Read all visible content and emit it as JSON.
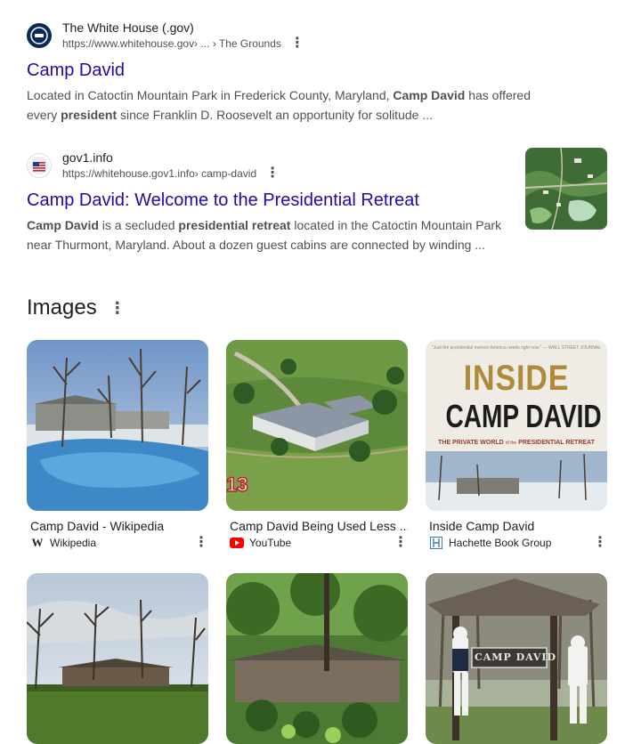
{
  "results": [
    {
      "site_name": "The White House (.gov)",
      "url": "https://www.whitehouse.gov",
      "breadcrumb": " › ... › The Grounds",
      "title": "Camp David",
      "snippet_parts": [
        "Located in Catoctin Mountain Park in Frederick County, Maryland, ",
        "Camp David",
        " has offered",
        "every ",
        "president",
        " since Franklin D. Roosevelt an opportunity for solitude ..."
      ]
    },
    {
      "site_name": "gov1.info",
      "url": "https://whitehouse.gov1.info",
      "breadcrumb": " › camp-david",
      "title": "Camp David: Welcome to the Presidential Retreat",
      "snippet_parts": [
        "Camp David",
        " is a secluded ",
        "presidential retreat",
        " located in the Catoctin Mountain Park",
        "near Thurmont, Maryland. About a dozen guest cabins are connected by winding ..."
      ]
    }
  ],
  "images_section": {
    "heading": "Images",
    "cards": [
      {
        "caption": "Camp David - Wikipedia",
        "source": "Wikipedia",
        "icon": "wikipedia-icon"
      },
      {
        "caption": "Camp David Being Used Less ...",
        "source": "YouTube",
        "icon": "youtube-icon"
      },
      {
        "caption": "Inside Camp David",
        "source": "Hachette Book Group",
        "icon": "hachette-icon"
      }
    ],
    "book_cover": {
      "quote": "\"Just the presidential memoir America needs right now.\" — WALL STREET JOURNAL",
      "line1": "INSIDE",
      "line2": "CAMP DAVID",
      "subtitle_a": "THE PRIVATE WORLD",
      "subtitle_b": "of the",
      "subtitle_c": "PRESIDENTIAL RETREAT"
    },
    "sign_text": "CAMP DAVID",
    "overlay_digits": "13"
  },
  "colors": {
    "link": "#1a0dab",
    "snippet": "#4d5156",
    "youtube": "#ff0000",
    "hachette": "#3a7bbf"
  }
}
